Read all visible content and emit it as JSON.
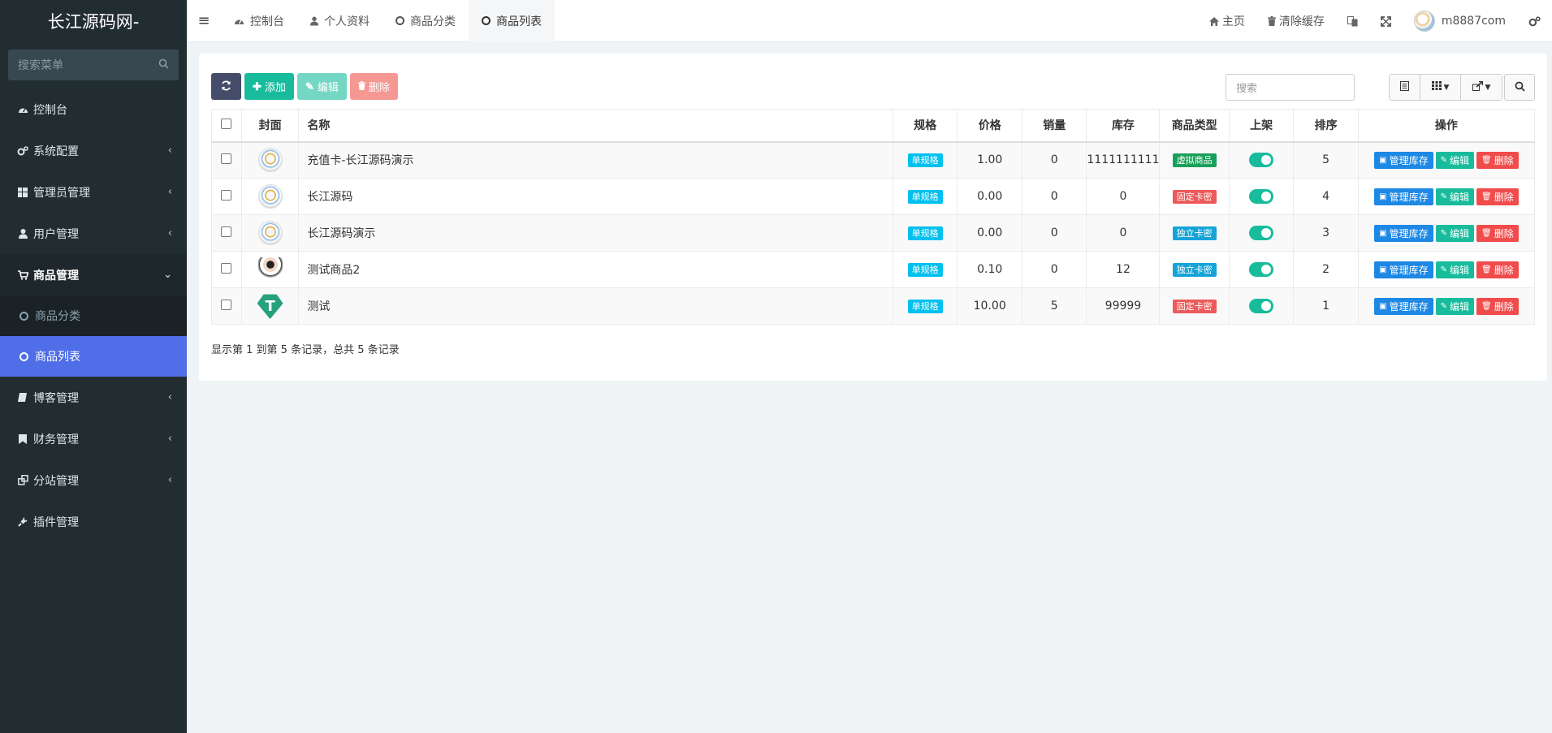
{
  "brand": "长江源码网-",
  "sidebar": {
    "search_placeholder": "搜索菜单",
    "items": [
      {
        "label": "控制台"
      },
      {
        "label": "系统配置"
      },
      {
        "label": "管理员管理"
      },
      {
        "label": "用户管理"
      },
      {
        "label": "商品管理"
      },
      {
        "label": "博客管理"
      },
      {
        "label": "财务管理"
      },
      {
        "label": "分站管理"
      },
      {
        "label": "插件管理"
      }
    ],
    "sub_items": [
      {
        "label": "商品分类"
      },
      {
        "label": "商品列表"
      }
    ]
  },
  "topnav": {
    "tabs": [
      {
        "label": "控制台"
      },
      {
        "label": "个人资料"
      },
      {
        "label": "商品分类"
      },
      {
        "label": "商品列表"
      }
    ],
    "home": "主页",
    "clear_cache": "清除缓存",
    "username": "m8887com"
  },
  "toolbar": {
    "add": "添加",
    "edit": "编辑",
    "delete": "删除",
    "search_placeholder": "搜索"
  },
  "table": {
    "headers": [
      "封面",
      "名称",
      "规格",
      "价格",
      "销量",
      "库存",
      "商品类型",
      "上架",
      "排序",
      "操作"
    ],
    "rows": [
      {
        "name": "充值卡-长江源码演示",
        "spec": "单规格",
        "price": "1.00",
        "sales": "0",
        "stock": "1111111111",
        "type": "虚拟商品",
        "sort": "5"
      },
      {
        "name": "长江源码",
        "spec": "单规格",
        "price": "0.00",
        "sales": "0",
        "stock": "0",
        "type": "固定卡密",
        "sort": "4"
      },
      {
        "name": "长江源码演示",
        "spec": "单规格",
        "price": "0.00",
        "sales": "0",
        "stock": "0",
        "type": "独立卡密",
        "sort": "3"
      },
      {
        "name": "测试商品2",
        "spec": "单规格",
        "price": "0.10",
        "sales": "0",
        "stock": "12",
        "type": "独立卡密",
        "sort": "2"
      },
      {
        "name": "测试",
        "spec": "单规格",
        "price": "10.00",
        "sales": "5",
        "stock": "99999",
        "type": "固定卡密",
        "sort": "1"
      }
    ],
    "ops": {
      "stock": "管理库存",
      "edit": "编辑",
      "delete": "删除"
    }
  },
  "pagination_text": "显示第 1 到第 5 条记录，总共 5 条记录",
  "colors": {
    "sidebar": "#222d32",
    "active": "#4f6ee8",
    "accent": "#18bc9c"
  }
}
